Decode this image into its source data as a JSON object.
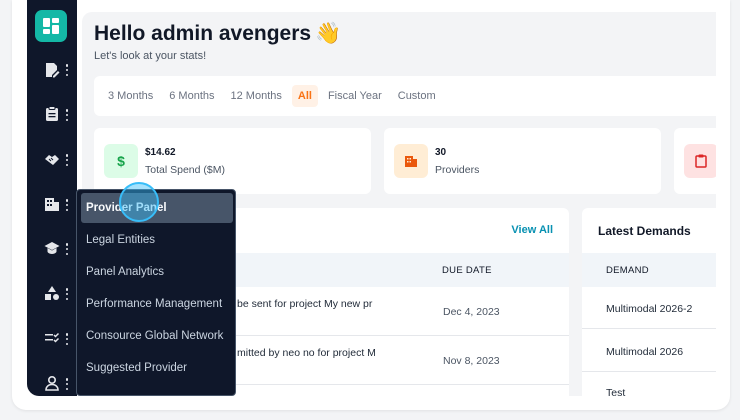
{
  "header": {
    "greeting": "Hello admin avengers",
    "wave_emoji": "👋",
    "subtitle": "Let's look at your stats!"
  },
  "time_filters": [
    {
      "label": "3 Months",
      "active": false
    },
    {
      "label": "6 Months",
      "active": false
    },
    {
      "label": "12 Months",
      "active": false
    },
    {
      "label": "All",
      "active": true
    },
    {
      "label": "Fiscal Year",
      "active": false
    },
    {
      "label": "Custom",
      "active": false
    }
  ],
  "stats": [
    {
      "value": "$14.62",
      "label": "Total Spend ($M)",
      "icon": "dollar-icon",
      "color": "#16a34a",
      "bg": "#dcfce7"
    },
    {
      "value": "30",
      "label": "Providers",
      "icon": "building-icon",
      "color": "#ea580c",
      "bg": "#ffedd5"
    },
    {
      "value": "",
      "label": "",
      "icon": "clipboard-icon",
      "color": "#dc2626",
      "bg": "#fee2e2"
    }
  ],
  "tasks_panel": {
    "view_all": "View All",
    "due_date_header": "DUE DATE",
    "rows": [
      {
        "text": "be sent for project My new pr",
        "due": "Dec 4, 2023"
      },
      {
        "text": "mitted by neo no for project M",
        "due": "Nov 8, 2023"
      }
    ]
  },
  "demands_panel": {
    "title": "Latest Demands",
    "header": "DEMAND",
    "rows": [
      "Multimodal 2026-2",
      "Multimodal 2026",
      "Test"
    ]
  },
  "sidebar": {
    "items": [
      {
        "icon": "dashboard-icon"
      },
      {
        "icon": "document-edit-icon"
      },
      {
        "icon": "clipboard-icon"
      },
      {
        "icon": "handshake-icon"
      },
      {
        "icon": "building-icon"
      },
      {
        "icon": "graduation-cap-icon"
      },
      {
        "icon": "shapes-icon"
      },
      {
        "icon": "checklist-icon"
      },
      {
        "icon": "user-icon"
      }
    ]
  },
  "flyout_menu": {
    "items": [
      {
        "label": "Provider Panel",
        "active": true
      },
      {
        "label": "Legal Entities",
        "active": false
      },
      {
        "label": "Panel Analytics",
        "active": false
      },
      {
        "label": "Performance Management",
        "active": false
      },
      {
        "label": "Consource Global Network",
        "active": false
      },
      {
        "label": "Suggested Provider",
        "active": false
      }
    ]
  },
  "colors": {
    "accent": "#f97316",
    "teal": "#14b8a6",
    "link": "#0891b2",
    "sidebar_bg": "#0f172a"
  }
}
